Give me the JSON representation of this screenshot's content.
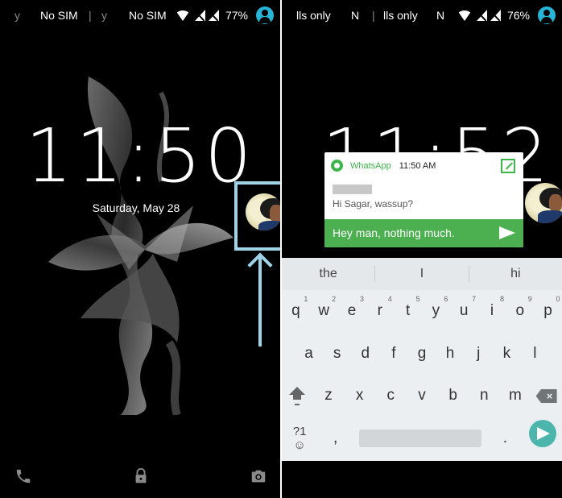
{
  "left_screen": {
    "status_bar": {
      "carrier_fragment_1": "y",
      "carrier_1": "No SIM",
      "separator": "|",
      "carrier_fragment_2": "y",
      "carrier_2": "No SIM",
      "battery": "77%"
    },
    "clock": "11:50",
    "date": "Saturday, May 28",
    "bottom_shortcuts": [
      "phone-icon",
      "lock-icon",
      "camera-icon"
    ]
  },
  "right_screen": {
    "status_bar": {
      "carrier_1": "lls only",
      "carrier_fragment_1": "N",
      "separator": "|",
      "carrier_2": "lls only",
      "carrier_fragment_2": "N",
      "battery": "76%"
    },
    "clock": "11:52",
    "notification": {
      "app": "WhatsApp",
      "time": "11:50 AM",
      "message": "Hi Sagar, wassup?",
      "reply_text": "Hey man, nothing much.",
      "accent": "#4caf50"
    },
    "keyboard": {
      "suggestions": [
        "the",
        "I",
        "hi"
      ],
      "row1": [
        {
          "k": "q",
          "n": "1"
        },
        {
          "k": "w",
          "n": "2"
        },
        {
          "k": "e",
          "n": "3"
        },
        {
          "k": "r",
          "n": "4"
        },
        {
          "k": "t",
          "n": "5"
        },
        {
          "k": "y",
          "n": "6"
        },
        {
          "k": "u",
          "n": "7"
        },
        {
          "k": "i",
          "n": "8"
        },
        {
          "k": "o",
          "n": "9"
        },
        {
          "k": "p",
          "n": "0"
        }
      ],
      "row2": [
        "a",
        "s",
        "d",
        "f",
        "g",
        "h",
        "j",
        "k",
        "l"
      ],
      "row3": [
        "z",
        "x",
        "c",
        "v",
        "b",
        "n",
        "m"
      ],
      "symbols_label": "?1☺",
      "comma": ",",
      "period": ".",
      "enter_color": "#4db6ac"
    }
  },
  "colors": {
    "highlight": "#9fd4e8",
    "user_icon": "#26b5d6"
  }
}
